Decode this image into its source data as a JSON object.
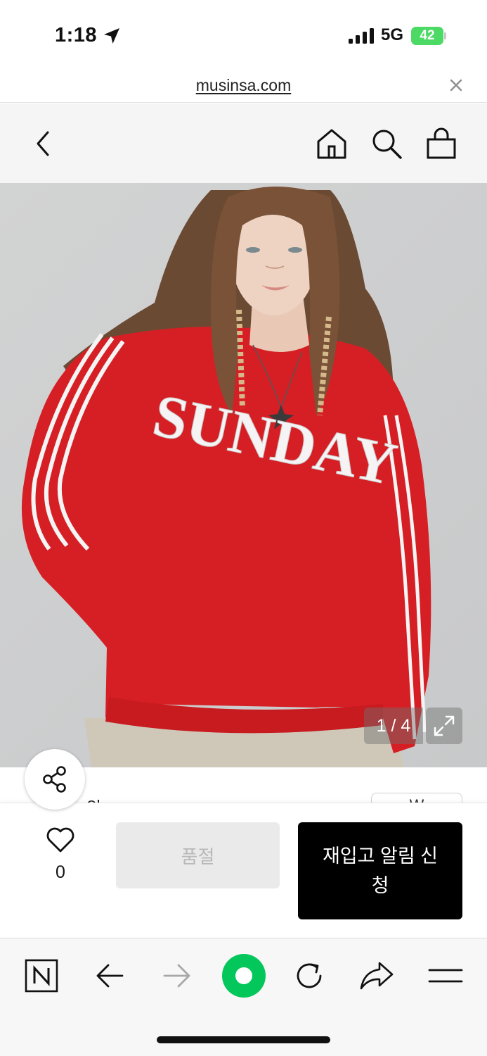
{
  "status_bar": {
    "time": "1:18",
    "network": "5G",
    "battery": "42",
    "icons": [
      "location-arrow-icon",
      "signal-bars-icon",
      "battery-charging-icon"
    ]
  },
  "browser": {
    "url": "musinsa.com",
    "close_icon": "close-icon"
  },
  "header": {
    "icons": [
      "chevron-left-icon",
      "home-icon",
      "search-icon",
      "shopping-bag-icon"
    ]
  },
  "product_image": {
    "sweatshirt_text": "SUNDAY",
    "counter": "1 / 4",
    "expand_icon": "expand-icon"
  },
  "info_peek": {
    "brand": "위",
    "pill": "₩"
  },
  "action_bar": {
    "like_count": "0",
    "soldout_label": "품절",
    "restock_label": "재입고 알림 신청"
  },
  "toolbar": {
    "icons": [
      "naver-n-icon",
      "back-arrow-icon",
      "forward-arrow-icon",
      "green-circle-icon",
      "reload-icon",
      "share-arrow-icon",
      "menu-icon"
    ]
  },
  "colors": {
    "accent_green": "#03c75a",
    "battery_green": "#4cd964",
    "sweatshirt_red": "#d61f24",
    "button_black": "#000000",
    "header_bg": "#f5f5f5"
  }
}
